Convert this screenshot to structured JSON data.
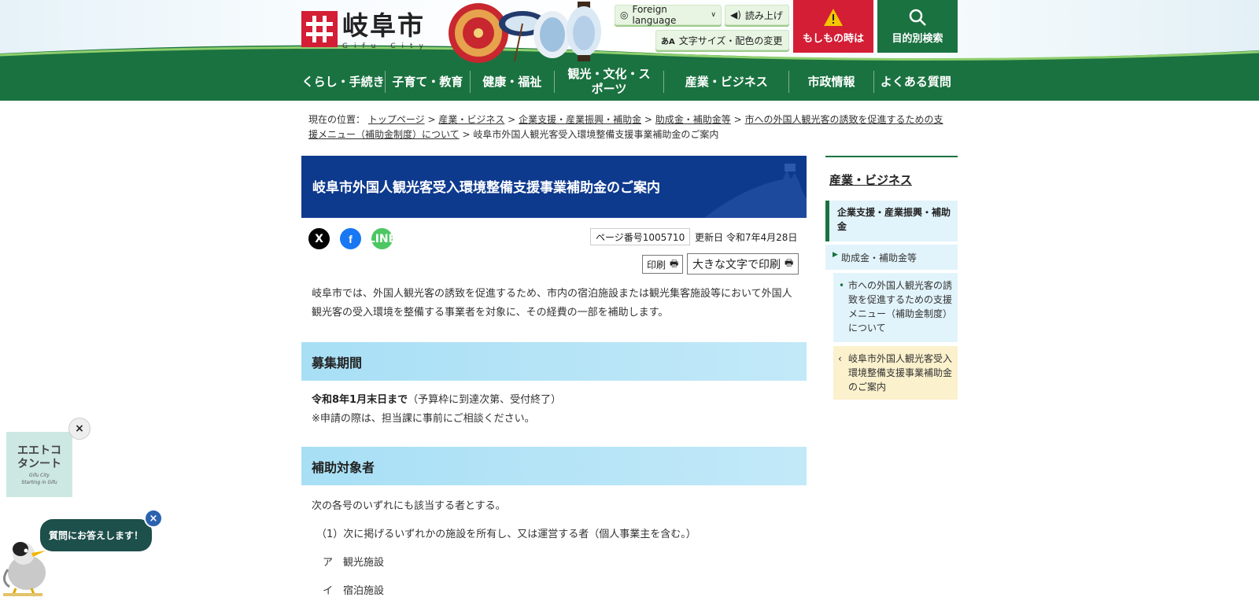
{
  "header": {
    "logo_jp": "岐阜市",
    "logo_en": "Gifu City",
    "foreign_language": "Foreign language",
    "read_aloud": "読み上げ",
    "text_size_color": "文字サイズ・配色の変更",
    "emergency": "もしもの時は",
    "search": "目的別検索"
  },
  "nav": {
    "items": [
      {
        "label": "くらし・手続き"
      },
      {
        "label": "子育て・教育"
      },
      {
        "label": "健康・福祉"
      },
      {
        "label": "観光・文化・スポーツ"
      },
      {
        "label": "産業・ビジネス"
      },
      {
        "label": "市政情報"
      },
      {
        "label": "よくある質問"
      }
    ]
  },
  "breadcrumb": {
    "prefix": "現在の位置：",
    "links": [
      "トップページ",
      "産業・ビジネス",
      "企業支援・産業振興・補助金",
      "助成金・補助金等",
      "市への外国人観光客の誘致を促進するための支援メニュー（補助金制度）について"
    ],
    "current": "岐阜市外国人観光客受入環境整備支援事業補助金のご案内",
    "separator": ">"
  },
  "main": {
    "title": "岐阜市外国人観光客受入環境整備支援事業補助金のご案内",
    "page_number": "ページ番号1005710",
    "updated": "更新日 令和7年4月28日",
    "print": "印刷",
    "print_large": "大きな文字で印刷",
    "intro": "岐阜市では、外国人観光客の誘致を促進するため、市内の宿泊施設または観光集客施設等において外国人観光客の受入環境を整備する事業者を対象に、その経費の一部を補助します。",
    "sec1_title": "募集期間",
    "sec1_bold": "令和8年1月末日まで",
    "sec1_rest": "（予算枠に到達次第、受付終了）",
    "sec1_note": "※申請の際は、担当課に事前にご相談ください。",
    "sec2_title": "補助対象者",
    "sec2_line1": "次の各号のいずれにも該当する者とする。",
    "sec2_line2": "（1）次に掲げるいずれかの施設を所有し、又は運営する者（個人事業主を含む。）",
    "sec2_line3": "ア　観光施設",
    "sec2_line4": "イ　宿泊施設"
  },
  "sidebar": {
    "title": "産業・ビジネス",
    "item1": "企業支援・産業振興・補助金",
    "item2": "助成金・補助金等",
    "item3": "市への外国人観光客の誘致を促進するための支援メニュー（補助金制度）について",
    "item4": "岐阜市外国人観光客受入環境整備支援事業補助金のご案内"
  },
  "widgets": {
    "ad_line1": "エエトコ",
    "ad_line2": "タンート",
    "ad_line3": "Gifu City",
    "ad_line4": "Starting in Gifu",
    "bubble": "質問にお答えします！",
    "close": "×"
  },
  "social": {
    "x": "X",
    "facebook": "f",
    "line": "LINE"
  },
  "colors": {
    "brand_green": "#1a7240",
    "title_blue": "#0e3a8e",
    "section_blue": "#a8dff5",
    "emergency_red": "#d31e35"
  }
}
